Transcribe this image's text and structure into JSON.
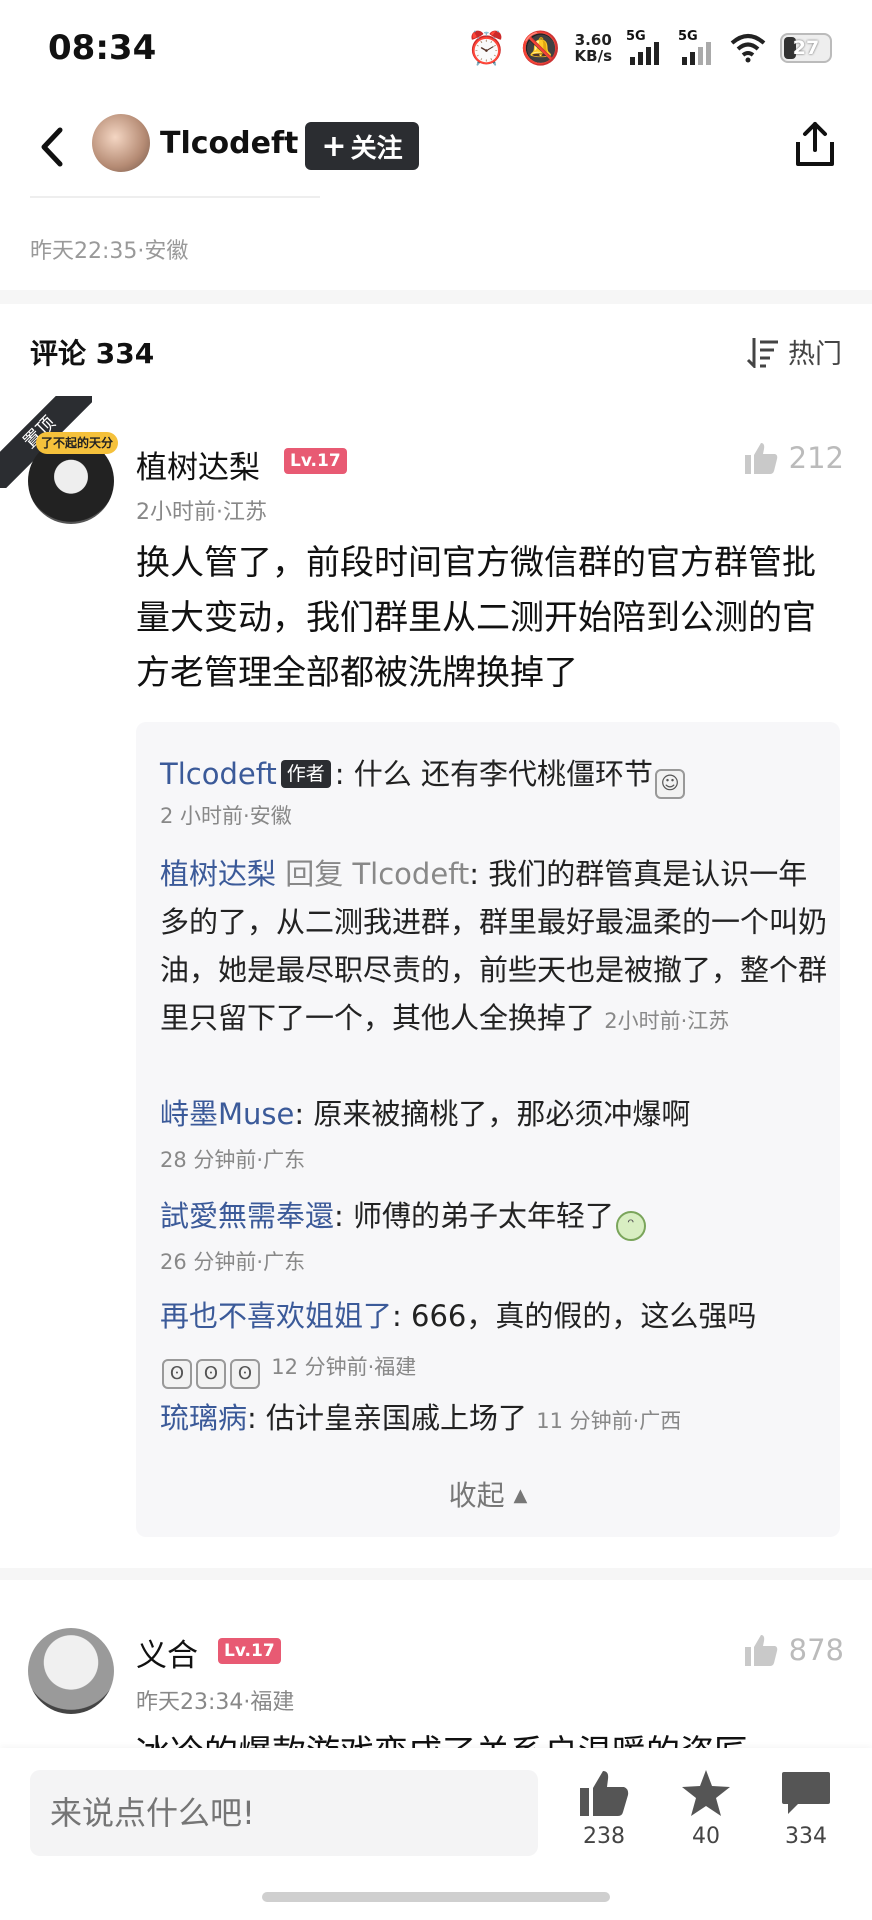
{
  "status_bar": {
    "time": "08:34",
    "net_speed_value": "3.60",
    "net_speed_unit": "KB/s",
    "signal_1": "5G",
    "signal_2": "5G",
    "battery": "27"
  },
  "header": {
    "author_name": "Tlcodeft",
    "follow_label": "关注"
  },
  "post": {
    "meta": "昨天22:35·安徽"
  },
  "comments": {
    "title": "评论 334",
    "sort_label": "热门",
    "pinned_label": "置顶",
    "items": [
      {
        "badge": "了不起的天分",
        "name": "植树达梨",
        "level": "Lv.17",
        "likes": "212",
        "meta": "2小时前·江苏",
        "text": "换人管了，前段时间官方微信群的官方群管批量大变动，我们群里从二测开始陪到公测的官方老管理全部都被洗牌换掉了",
        "replies": [
          {
            "name": "Tlcodeft",
            "tag": "作者",
            "text": ": 什么 还有李代桃僵环节",
            "meta": "2 小时前·安徽"
          },
          {
            "name": "植树达梨",
            "reply_prefix": " 回复 Tlcodeft",
            "text": ": 我们的群管真是认识一年多的了，从二测我进群，群里最好最温柔的一个叫奶油，她是最尽职尽责的，前些天也是被撤了，整个群里只留下了一个，其他人全换掉了",
            "meta": "2小时前·江苏"
          },
          {
            "name": "峙墨Muse",
            "text": ": 原来被摘桃了，那必须冲爆啊",
            "meta": "28 分钟前·广东"
          },
          {
            "name": "試愛無需奉還",
            "text": ": 师傅的弟子太年轻了",
            "meta": "26 分钟前·广东"
          },
          {
            "name": "再也不喜欢姐姐了",
            "text": ": 666，真的假的，这么强吗",
            "meta": "12 分钟前·福建"
          },
          {
            "name": "琉璃病",
            "text": ": 估计皇亲国戚上场了",
            "meta": "11 分钟前·广西"
          }
        ],
        "collapse_label": "收起"
      },
      {
        "name": "义合",
        "level": "Lv.17",
        "likes": "878",
        "meta": "昨天23:34·福建",
        "text": "冰冷的爆款游戏变成了关系户温暖的姿匠"
      }
    ]
  },
  "bottom_bar": {
    "input_placeholder": "来说点什么吧!",
    "like_count": "238",
    "star_count": "40",
    "comment_count": "334"
  },
  "colors": {
    "accent_dark": "#2b2d31",
    "level_badge": "#e85a73",
    "reply_name": "#3b5a99"
  }
}
